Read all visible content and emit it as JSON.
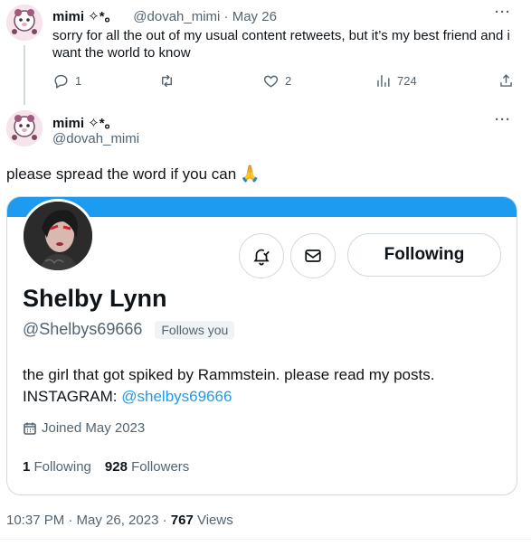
{
  "top_tweet": {
    "name": "mimi ✧*。",
    "handle": "@dovah_mimi",
    "date": "May 26",
    "text": "sorry for all the out of my usual content retweets, but it’s my best friend and i want the world to know",
    "replies": "1",
    "likes": "2",
    "views": "724",
    "icons": [
      "reply-icon",
      "retweet-icon",
      "like-icon",
      "views-icon",
      "share-icon"
    ]
  },
  "main_tweet": {
    "name": "mimi ✧*。",
    "handle": "@dovah_mimi",
    "text": "please spread the word if you can",
    "emoji": "🙏",
    "timestamp": "10:37 PM · May 26, 2023 · ",
    "views_count": "767",
    "views_label": " Views"
  },
  "profile_card": {
    "display_name": "Shelby Lynn",
    "handle": "@Shelbys69666",
    "follows_you": "Follows you",
    "follow_button": "Following",
    "bio": "the girl that got spiked by Rammstein. please read my posts.",
    "bio_prefix": "INSTAGRAM: ",
    "bio_link": "@shelbys69666",
    "joined": "Joined May 2023",
    "following_count": "1",
    "following_label": "Following",
    "followers_count": "928",
    "followers_label": "Followers",
    "banner_color": "#1d9bf0"
  },
  "more_label": "···"
}
